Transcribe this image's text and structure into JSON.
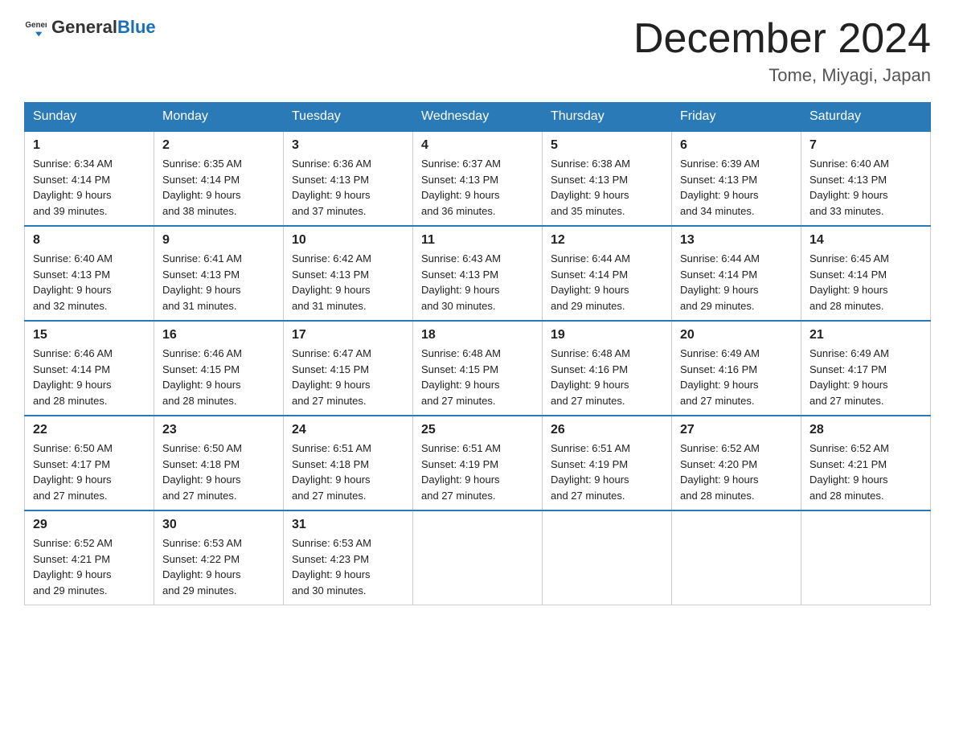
{
  "header": {
    "logo_general": "General",
    "logo_blue": "Blue",
    "month_title": "December 2024",
    "location": "Tome, Miyagi, Japan"
  },
  "days_of_week": [
    "Sunday",
    "Monday",
    "Tuesday",
    "Wednesday",
    "Thursday",
    "Friday",
    "Saturday"
  ],
  "weeks": [
    [
      {
        "day": "1",
        "sunrise": "6:34 AM",
        "sunset": "4:14 PM",
        "daylight": "9 hours and 39 minutes."
      },
      {
        "day": "2",
        "sunrise": "6:35 AM",
        "sunset": "4:14 PM",
        "daylight": "9 hours and 38 minutes."
      },
      {
        "day": "3",
        "sunrise": "6:36 AM",
        "sunset": "4:13 PM",
        "daylight": "9 hours and 37 minutes."
      },
      {
        "day": "4",
        "sunrise": "6:37 AM",
        "sunset": "4:13 PM",
        "daylight": "9 hours and 36 minutes."
      },
      {
        "day": "5",
        "sunrise": "6:38 AM",
        "sunset": "4:13 PM",
        "daylight": "9 hours and 35 minutes."
      },
      {
        "day": "6",
        "sunrise": "6:39 AM",
        "sunset": "4:13 PM",
        "daylight": "9 hours and 34 minutes."
      },
      {
        "day": "7",
        "sunrise": "6:40 AM",
        "sunset": "4:13 PM",
        "daylight": "9 hours and 33 minutes."
      }
    ],
    [
      {
        "day": "8",
        "sunrise": "6:40 AM",
        "sunset": "4:13 PM",
        "daylight": "9 hours and 32 minutes."
      },
      {
        "day": "9",
        "sunrise": "6:41 AM",
        "sunset": "4:13 PM",
        "daylight": "9 hours and 31 minutes."
      },
      {
        "day": "10",
        "sunrise": "6:42 AM",
        "sunset": "4:13 PM",
        "daylight": "9 hours and 31 minutes."
      },
      {
        "day": "11",
        "sunrise": "6:43 AM",
        "sunset": "4:13 PM",
        "daylight": "9 hours and 30 minutes."
      },
      {
        "day": "12",
        "sunrise": "6:44 AM",
        "sunset": "4:14 PM",
        "daylight": "9 hours and 29 minutes."
      },
      {
        "day": "13",
        "sunrise": "6:44 AM",
        "sunset": "4:14 PM",
        "daylight": "9 hours and 29 minutes."
      },
      {
        "day": "14",
        "sunrise": "6:45 AM",
        "sunset": "4:14 PM",
        "daylight": "9 hours and 28 minutes."
      }
    ],
    [
      {
        "day": "15",
        "sunrise": "6:46 AM",
        "sunset": "4:14 PM",
        "daylight": "9 hours and 28 minutes."
      },
      {
        "day": "16",
        "sunrise": "6:46 AM",
        "sunset": "4:15 PM",
        "daylight": "9 hours and 28 minutes."
      },
      {
        "day": "17",
        "sunrise": "6:47 AM",
        "sunset": "4:15 PM",
        "daylight": "9 hours and 27 minutes."
      },
      {
        "day": "18",
        "sunrise": "6:48 AM",
        "sunset": "4:15 PM",
        "daylight": "9 hours and 27 minutes."
      },
      {
        "day": "19",
        "sunrise": "6:48 AM",
        "sunset": "4:16 PM",
        "daylight": "9 hours and 27 minutes."
      },
      {
        "day": "20",
        "sunrise": "6:49 AM",
        "sunset": "4:16 PM",
        "daylight": "9 hours and 27 minutes."
      },
      {
        "day": "21",
        "sunrise": "6:49 AM",
        "sunset": "4:17 PM",
        "daylight": "9 hours and 27 minutes."
      }
    ],
    [
      {
        "day": "22",
        "sunrise": "6:50 AM",
        "sunset": "4:17 PM",
        "daylight": "9 hours and 27 minutes."
      },
      {
        "day": "23",
        "sunrise": "6:50 AM",
        "sunset": "4:18 PM",
        "daylight": "9 hours and 27 minutes."
      },
      {
        "day": "24",
        "sunrise": "6:51 AM",
        "sunset": "4:18 PM",
        "daylight": "9 hours and 27 minutes."
      },
      {
        "day": "25",
        "sunrise": "6:51 AM",
        "sunset": "4:19 PM",
        "daylight": "9 hours and 27 minutes."
      },
      {
        "day": "26",
        "sunrise": "6:51 AM",
        "sunset": "4:19 PM",
        "daylight": "9 hours and 27 minutes."
      },
      {
        "day": "27",
        "sunrise": "6:52 AM",
        "sunset": "4:20 PM",
        "daylight": "9 hours and 28 minutes."
      },
      {
        "day": "28",
        "sunrise": "6:52 AM",
        "sunset": "4:21 PM",
        "daylight": "9 hours and 28 minutes."
      }
    ],
    [
      {
        "day": "29",
        "sunrise": "6:52 AM",
        "sunset": "4:21 PM",
        "daylight": "9 hours and 29 minutes."
      },
      {
        "day": "30",
        "sunrise": "6:53 AM",
        "sunset": "4:22 PM",
        "daylight": "9 hours and 29 minutes."
      },
      {
        "day": "31",
        "sunrise": "6:53 AM",
        "sunset": "4:23 PM",
        "daylight": "9 hours and 30 minutes."
      },
      null,
      null,
      null,
      null
    ]
  ]
}
